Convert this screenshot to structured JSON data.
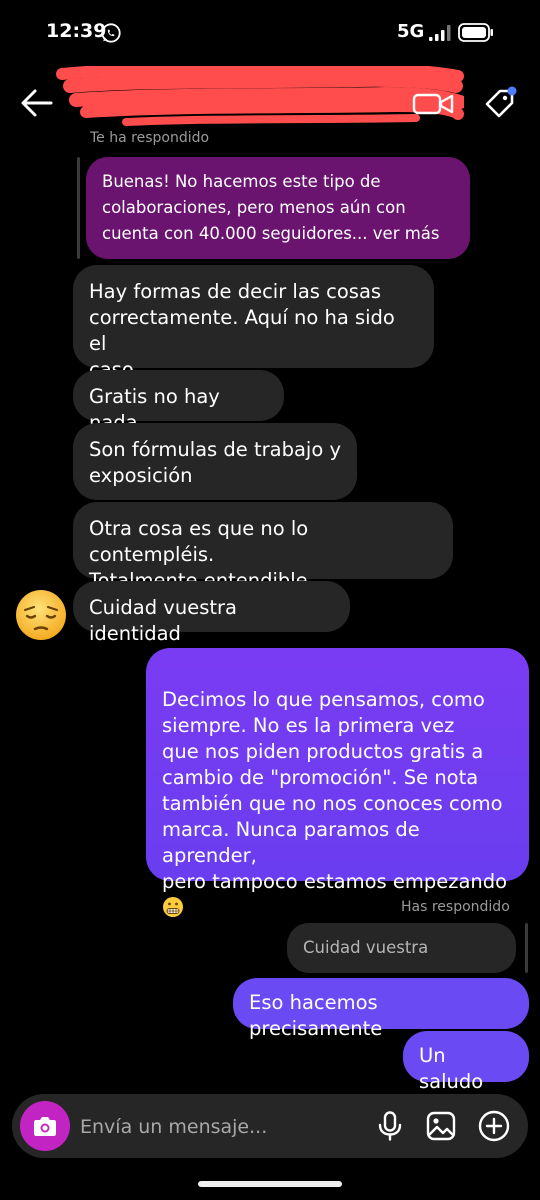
{
  "status_bar": {
    "time": "12:39",
    "network": "5G",
    "icons": [
      "whatsapp-icon",
      "signal-icon",
      "battery-icon"
    ]
  },
  "header": {
    "icons": [
      "back-arrow-icon",
      "video-call-icon",
      "tag-icon"
    ],
    "redaction_color": "#ff4d4d"
  },
  "conversation": {
    "reply_label_them": "Te ha respondido",
    "quoted_message_them": "Buenas! No hacemos este tipo de colaboraciones, pero menos aún con cuenta con 40.000 seguidores... ver más",
    "incoming_messages": [
      "Hay formas de decir las cosas\ncorrectamente. Aquí no ha sido el\ncaso",
      "Gratis no hay nada",
      "Son fórmulas de trabajo y\nexposición",
      "Otra cosa es que no lo contempléis.\nTotalmente entendible",
      "Cuidad vuestra identidad"
    ],
    "reaction_emoji_name": "pensive-face-icon",
    "outgoing_long_message": "Decimos lo que pensamos, como\nsiempre. No es la primera vez\nque nos piden productos gratis a\ncambio de \"promoción\". Se nota\ntambién que no nos conoces como\nmarca. Nunca paramos de aprender,\npero tampoco estamos empezando",
    "outgoing_long_emoji": "grimacing-face-icon",
    "reply_label_me": "Has respondido",
    "quoted_message_me": "Cuidad vuestra identidad",
    "outgoing_short_messages": [
      "Eso hacemos precisamente",
      "Un saludo"
    ]
  },
  "composer": {
    "placeholder": "Envía un mensaje...",
    "value": "",
    "icons": [
      "camera-icon",
      "microphone-icon",
      "gallery-icon",
      "add-icon"
    ]
  },
  "colors": {
    "incoming_bubble": "#262626",
    "outgoing_bubble": "#6a3df0",
    "quoted_purple": "#6a1470",
    "camera_button": "#c224c4"
  }
}
